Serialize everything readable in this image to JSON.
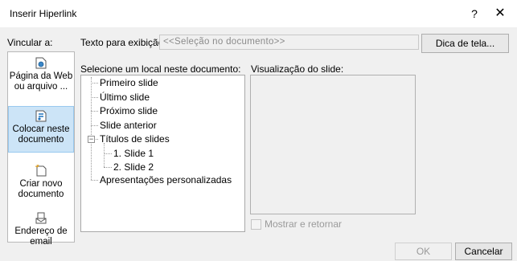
{
  "window": {
    "title": "Inserir Hiperlink",
    "help_label": "?",
    "close_label": "✕"
  },
  "link_to": {
    "label": "Vincular a:",
    "items": [
      {
        "label": "Página da Web ou arquivo ...",
        "icon": "web-page-icon",
        "selected": false
      },
      {
        "label": "Colocar neste documento",
        "icon": "place-in-document-icon",
        "selected": true
      },
      {
        "label": "Criar novo documento",
        "icon": "new-document-icon",
        "selected": false
      },
      {
        "label": "Endereço de email",
        "icon": "email-icon",
        "selected": false
      }
    ]
  },
  "display_text": {
    "label": "Texto para exibição:",
    "value": "<<Seleção no documento>>"
  },
  "screen_tip_button": "Dica de tela...",
  "place": {
    "label": "Selecione um local neste documento:",
    "tree": [
      {
        "label": "Primeiro slide"
      },
      {
        "label": "Último slide"
      },
      {
        "label": "Próximo slide"
      },
      {
        "label": "Slide anterior"
      },
      {
        "label": "Títulos de slides",
        "expanded": true,
        "expander": "−",
        "children": [
          {
            "label": "1. Slide 1"
          },
          {
            "label": "2. Slide 2"
          }
        ]
      },
      {
        "label": "Apresentações personalizadas"
      }
    ]
  },
  "preview": {
    "label": "Visualização do slide:",
    "show_and_return_label": "Mostrar e retornar",
    "show_and_return_checked": false
  },
  "buttons": {
    "ok": "OK",
    "cancel": "Cancelar"
  }
}
